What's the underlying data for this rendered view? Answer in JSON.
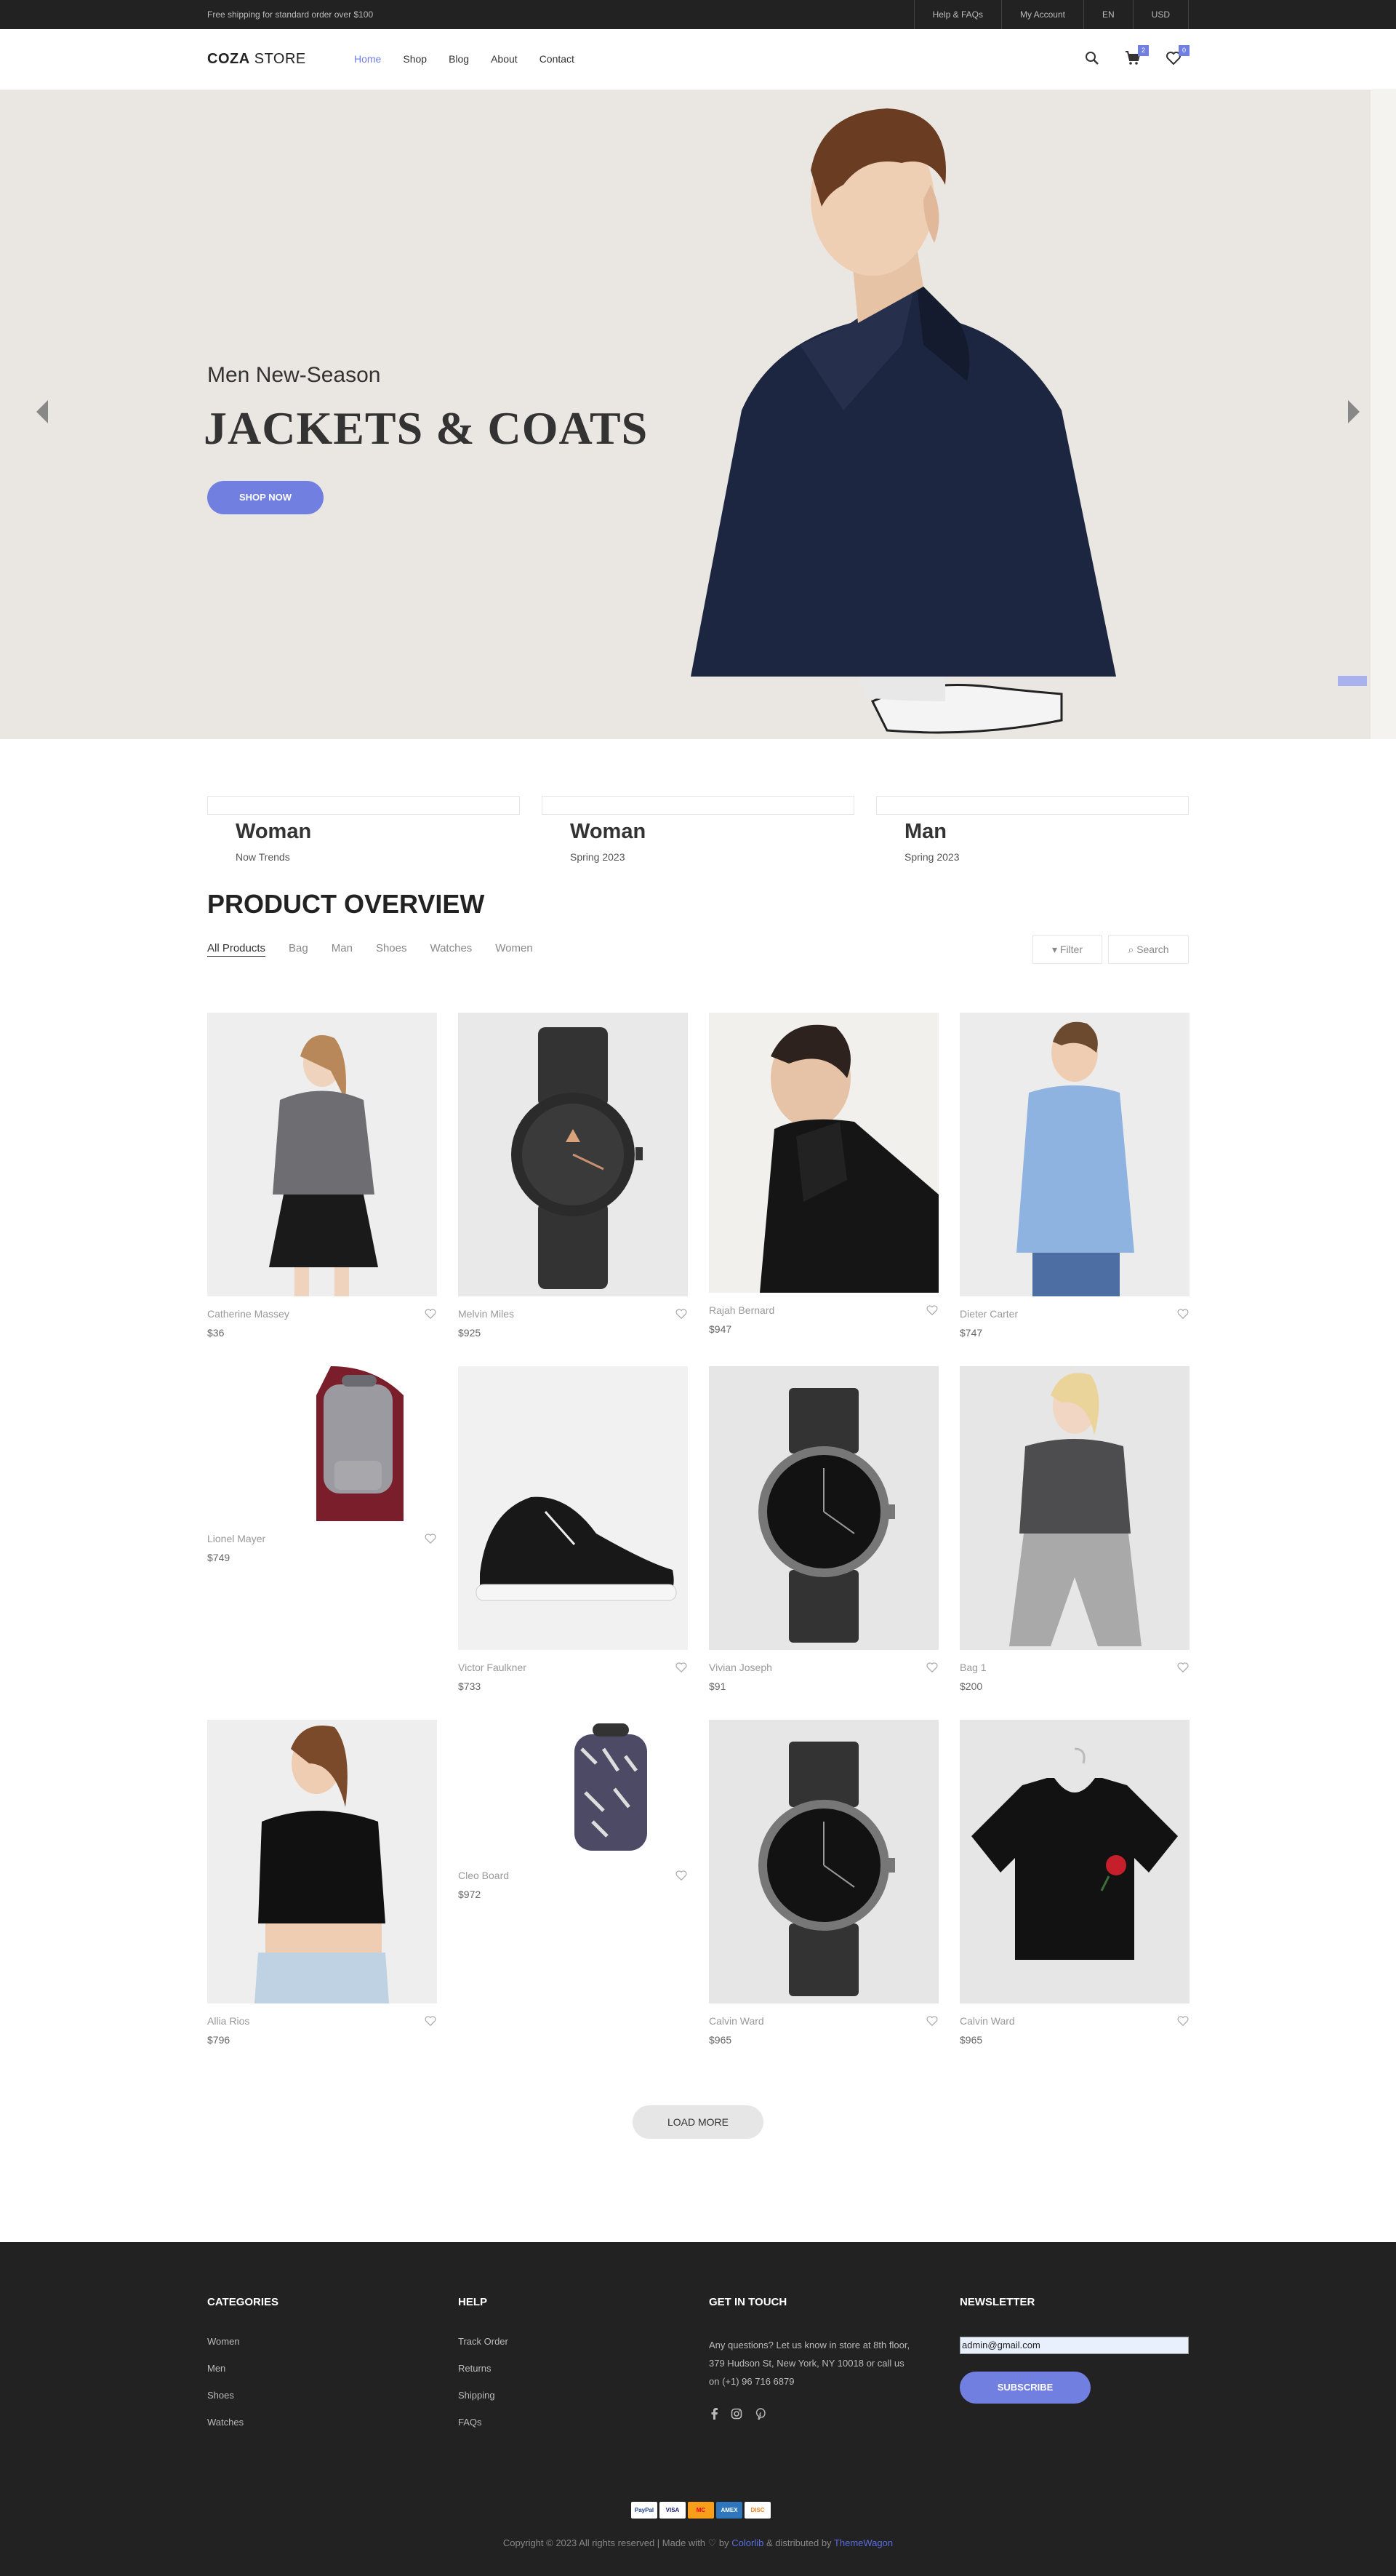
{
  "topbar": {
    "message": "Free shipping for standard order over $100",
    "links": [
      "Help & FAQs",
      "My Account",
      "EN",
      "USD"
    ]
  },
  "header": {
    "logo_bold": "COZA",
    "logo_light": " STORE",
    "nav": [
      "Home",
      "Shop",
      "Blog",
      "About",
      "Contact"
    ],
    "cart_count": "2",
    "wishlist_count": "0",
    "accent": "#717fe0"
  },
  "hero": {
    "subtitle": "Men New-Season",
    "title": "JACKETS & COATS",
    "button": "SHOP NOW"
  },
  "banners": [
    {
      "title": "Woman",
      "subtitle": "Now Trends"
    },
    {
      "title": "Woman",
      "subtitle": "Spring 2023"
    },
    {
      "title": "Man",
      "subtitle": "Spring 2023"
    }
  ],
  "overview": {
    "title": "PRODUCT OVERVIEW",
    "filters": [
      "All Products",
      "Bag",
      "Man",
      "Shoes",
      "Watches",
      "Women"
    ],
    "filter_button": "Filter",
    "search_button": "Search",
    "load_more": "LOAD MORE"
  },
  "products": [
    {
      "name": "Catherine Massey",
      "price": "$36",
      "icon": "woman-grey-shirt"
    },
    {
      "name": "Melvin Miles",
      "price": "$925",
      "icon": "black-watch"
    },
    {
      "name": "Rajah Bernard",
      "price": "$947",
      "icon": "man-black-jacket"
    },
    {
      "name": "Dieter Carter",
      "price": "$747",
      "icon": "man-blue-shirt"
    },
    {
      "name": "Lionel Mayer",
      "price": "$749",
      "icon": "grey-backpack"
    },
    {
      "name": "Victor Faulkner",
      "price": "$733",
      "icon": "black-sneaker"
    },
    {
      "name": "Vivian Joseph",
      "price": "$91",
      "icon": "dark-watch"
    },
    {
      "name": "Bag 1",
      "price": "$200",
      "icon": "woman-grey-tee"
    },
    {
      "name": "Allia Rios",
      "price": "$796",
      "icon": "woman-black-top"
    },
    {
      "name": "Cleo Board",
      "price": "$972",
      "icon": "patterned-backpack"
    },
    {
      "name": "Calvin Ward",
      "price": "$965",
      "icon": "dark-watch"
    },
    {
      "name": "Calvin Ward",
      "price": "$965",
      "icon": "black-tee-rose"
    }
  ],
  "footer": {
    "categories_title": "CATEGORIES",
    "categories": [
      "Women",
      "Men",
      "Shoes",
      "Watches"
    ],
    "help_title": "HELP",
    "help": [
      "Track Order",
      "Returns",
      "Shipping",
      "FAQs"
    ],
    "contact_title": "GET IN TOUCH",
    "contact_text": "Any questions? Let us know in store at 8th floor, 379 Hudson St, New York, NY 10018 or call us on (+1) 96 716 6879",
    "newsletter_title": "NEWSLETTER",
    "newsletter_value": "admin@gmail.com",
    "subscribe": "SUBSCRIBE",
    "payments": [
      "PayPal",
      "VISA",
      "MC",
      "AMEX",
      "DISC"
    ],
    "copyright_pre": "Copyright © 2023 All rights reserved | Made with ♡ by ",
    "copyright_brand1": "Colorlib",
    "copyright_mid": " & distributed by ",
    "copyright_brand2": "ThemeWagon"
  }
}
